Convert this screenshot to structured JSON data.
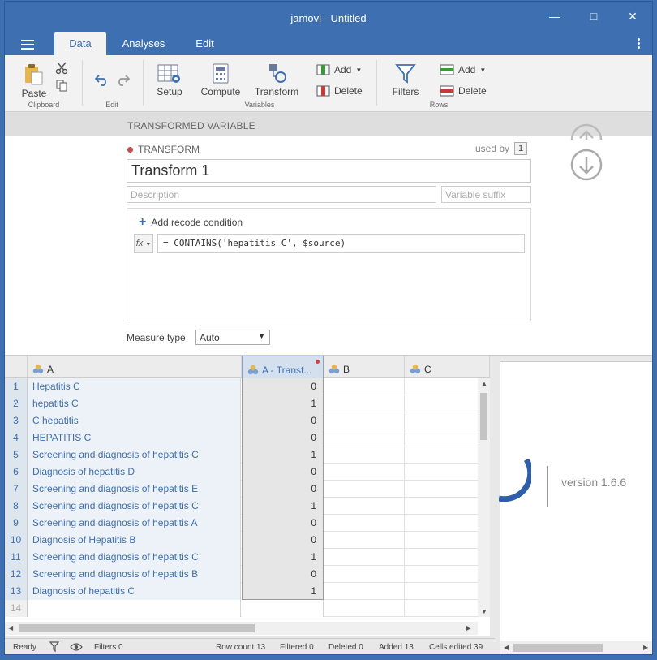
{
  "window": {
    "title": "jamovi - Untitled"
  },
  "menu": {
    "tabs": [
      "Data",
      "Analyses",
      "Edit"
    ]
  },
  "ribbon": {
    "clipboard": {
      "paste": "Paste",
      "group": "Clipboard"
    },
    "edit": {
      "group": "Edit"
    },
    "variables": {
      "setup": "Setup",
      "compute": "Compute",
      "transform": "Transform",
      "add": "Add",
      "delete": "Delete",
      "group": "Variables"
    },
    "rows": {
      "filters": "Filters",
      "add": "Add",
      "delete": "Delete",
      "group": "Rows"
    }
  },
  "editor": {
    "header": "TRANSFORMED VARIABLE",
    "type_label": "TRANSFORM",
    "used_by_label": "used by",
    "used_by_count": "1",
    "name": "Transform 1",
    "description_placeholder": "Description",
    "suffix_placeholder": "Variable suffix",
    "add_condition": "Add recode condition",
    "fx_label": "fx",
    "formula": "= CONTAINS('hepatitis C', $source)",
    "measure_label": "Measure type",
    "measure_value": "Auto"
  },
  "grid": {
    "columns": [
      {
        "name": "A"
      },
      {
        "name": "A - Transf..."
      },
      {
        "name": "B"
      },
      {
        "name": "C"
      }
    ],
    "rows": [
      {
        "n": "1",
        "a": "Hepatitis C",
        "t": "0"
      },
      {
        "n": "2",
        "a": "hepatitis C",
        "t": "1"
      },
      {
        "n": "3",
        "a": "C hepatitis",
        "t": "0"
      },
      {
        "n": "4",
        "a": "HEPATITIS C",
        "t": "0"
      },
      {
        "n": "5",
        "a": "Screening and diagnosis of hepatitis C",
        "t": "1"
      },
      {
        "n": "6",
        "a": "Diagnosis of hepatitis D",
        "t": "0"
      },
      {
        "n": "7",
        "a": "Screening and diagnosis of hepatitis E",
        "t": "0"
      },
      {
        "n": "8",
        "a": "Screening and diagnosis of hepatitis C",
        "t": "1"
      },
      {
        "n": "9",
        "a": "Screening and diagnosis of hepatitis A",
        "t": "0"
      },
      {
        "n": "10",
        "a": "Diagnosis of Hepatitis B",
        "t": "0"
      },
      {
        "n": "11",
        "a": "Screening and diagnosis of hepatitis C",
        "t": "1"
      },
      {
        "n": "12",
        "a": "Screening and diagnosis of hepatitis B",
        "t": "0"
      },
      {
        "n": "13",
        "a": "Diagnosis of hepatitis C",
        "t": "1"
      },
      {
        "n": "14",
        "a": "",
        "t": ""
      }
    ]
  },
  "results": {
    "version": "version 1.6.6"
  },
  "status": {
    "ready": "Ready",
    "filters": "Filters 0",
    "row_count": "Row count 13",
    "filtered": "Filtered 0",
    "deleted": "Deleted 0",
    "added": "Added 13",
    "cells_edited": "Cells edited 39"
  },
  "colors": {
    "accent": "#3e6fb0",
    "brand_arc": "#2f5fa8",
    "modified": "#d04040"
  }
}
